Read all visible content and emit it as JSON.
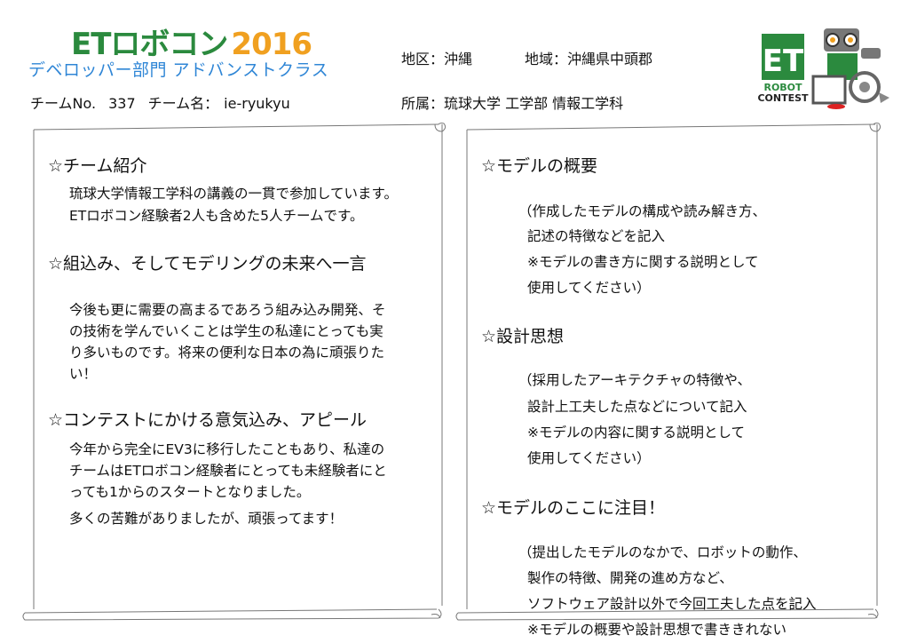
{
  "header": {
    "logo_et": "ET",
    "logo_robocon": "ロボコン",
    "logo_year": "2016",
    "subtitle": "デベロッパー部門 アドバンストクラス",
    "team_no_label": "チームNo.",
    "team_no_value": "337",
    "team_name_label": "チーム名：",
    "team_name_value": "ie-ryukyu",
    "district": "地区：沖縄",
    "region": "地域：沖縄県中頭郡",
    "affiliation": "所属：琉球大学 工学部 情報工学科",
    "badge_et": "ET",
    "badge_line1": "ROBOT",
    "badge_line2": "CONTEST"
  },
  "left": {
    "s1_title": "☆チーム紹介",
    "s1_lines": [
      "琉球大学情報工学科の講義の一貫で参加しています。",
      "ETロボコン経験者2人も含めた5人チームです。"
    ],
    "s2_title": "☆組込み、そしてモデリングの未来へ一言",
    "s2_lines": [
      "今後も更に需要の高まるであろう組み込み開発、そ",
      "の技術を学んでいくことは学生の私達にとっても実",
      "り多いものです。将来の便利な日本の為に頑張りた",
      "い！"
    ],
    "s3_title": "☆コンテストにかける意気込み、アピール",
    "s3_lines": [
      "今年から完全にEV3に移行したこともあり、私達の",
      "チームはETロボコン経験者にとっても未経験者にと",
      "っても1からのスタートとなりました。",
      "多くの苦難がありましたが、頑張ってます！"
    ]
  },
  "right": {
    "s1_title": "☆モデルの概要",
    "s1_lines": [
      "（作成したモデルの構成や読み解き方、",
      "記述の特徴などを記入",
      "※モデルの書き方に関する説明として",
      "使用してください）"
    ],
    "s2_title": "☆設計思想",
    "s2_lines": [
      "（採用したアーキテクチャの特徴や、",
      "設計上工夫した点などについて記入",
      "※モデルの内容に関する説明として",
      "使用してください）"
    ],
    "s3_title": "☆モデルのここに注目！",
    "s3_lines": [
      "（提出したモデルのなかで、ロボットの動作、",
      "製作の特徴、開発の進め方など、",
      "ソフトウェア設計以外で今回工夫した点を記入",
      "※モデルの概要や設計思想で書ききれない"
    ]
  },
  "colors": {
    "logo_green": "#2b8a3e",
    "logo_orange": "#f0a020",
    "subtitle_blue": "#2f86d6"
  }
}
